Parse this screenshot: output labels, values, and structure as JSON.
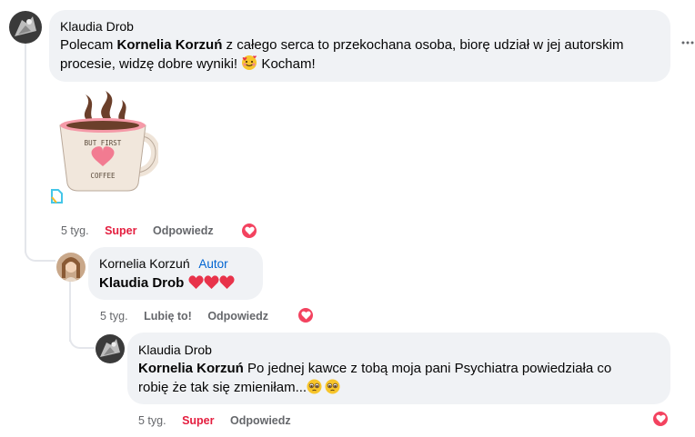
{
  "comment1": {
    "author": "Klaudia Drob",
    "text_prefix": "Polecam ",
    "mention": "Kornelia Korzuń",
    "text_suffix": " z całego serca to przekochana osoba, biorę udział w jej autorskim procesie, widzę dobre wyniki! ",
    "text_end": " Kocham!",
    "more_icon": "more-horizontal-icon",
    "sticker_lines": [
      "BUT FIRST",
      "COFFEE"
    ],
    "time": "5 tyg.",
    "reaction_label": "Super",
    "reply_label": "Odpowiedz",
    "reaction_icon": "heart-reaction-icon"
  },
  "comment2": {
    "author": "Kornelia Korzuń",
    "badge": "Autor",
    "mention": "Klaudia Drob",
    "time": "5 tyg.",
    "like_label": "Lubię to!",
    "reply_label": "Odpowiedz",
    "reaction_icon": "heart-reaction-icon"
  },
  "comment3": {
    "author": "Klaudia Drob",
    "mention": "Kornelia Korzuń",
    "text_line1": " Po jednej kawce z tobą moja pani Psychiatra powiedziała co",
    "text_line2": "robię że tak się zmieniłam...",
    "time": "5 tyg.",
    "reaction_label": "Super",
    "reply_label": "Odpowiedz",
    "reaction_icon": "heart-reaction-icon"
  },
  "colors": {
    "bubble": "#f0f2f5",
    "reaction_red": "#e41e3f",
    "secondary_text": "#65676b",
    "badge_blue": "#0064d1"
  }
}
